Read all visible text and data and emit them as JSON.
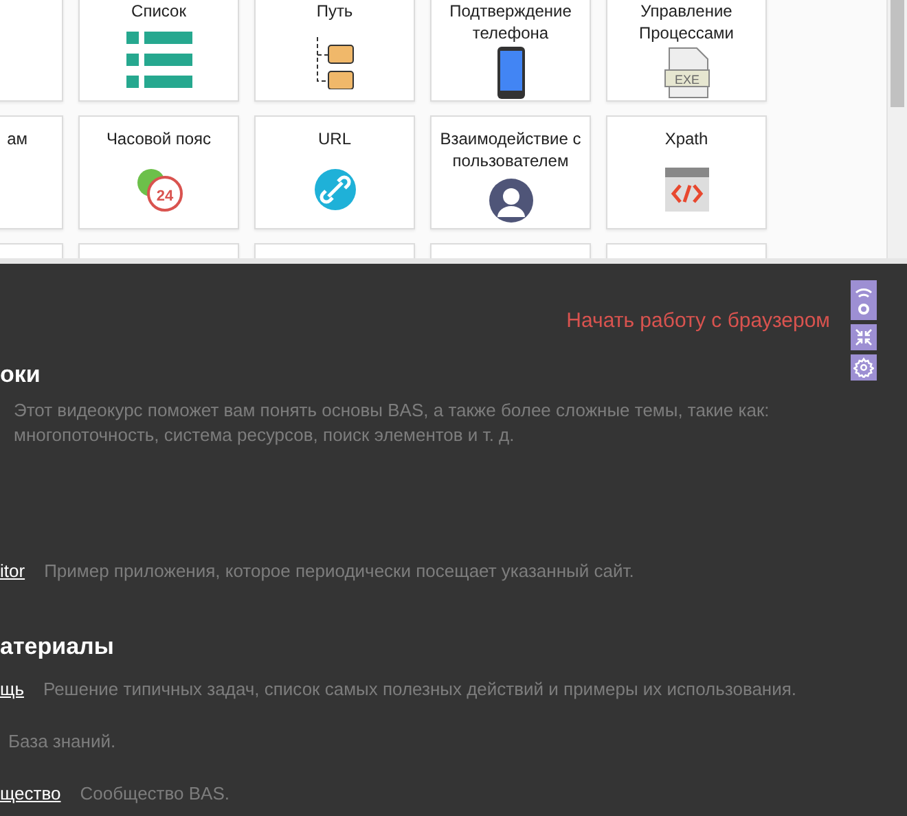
{
  "tool_grid": {
    "rows": [
      {
        "tiles": [
          {
            "label": "Список"
          },
          {
            "label": "Путь"
          },
          {
            "label": "Подтверждение телефона"
          },
          {
            "label": "Управление Процессами",
            "icon_text": "EXE"
          }
        ]
      },
      {
        "tiles": [
          {
            "label": "ам"
          },
          {
            "label": "Часовой пояс",
            "icon_text": "24"
          },
          {
            "label": "URL"
          },
          {
            "label": "Взаимодействие с пользователем"
          },
          {
            "label": "Xpath"
          }
        ]
      }
    ]
  },
  "start_link": "Начать работу с браузером",
  "sections": [
    {
      "heading": "оки",
      "paragraph": "Этот видеокурс поможет вам понять основы BAS, а также более сложные темы, такие как: многопоточность, система ресурсов, поиск элементов и т. д."
    },
    {
      "items": [
        {
          "link": "itor",
          "description": "Пример приложения, которое периодически посещает указанный сайт."
        }
      ]
    },
    {
      "heading": "атериалы",
      "items": [
        {
          "link": "щь",
          "description": "Решение типичных задач, список самых полезных действий и примеры их использования."
        },
        {
          "description": "База знаний."
        },
        {
          "link": "щество",
          "description": "Сообщество BAS."
        }
      ]
    }
  ]
}
